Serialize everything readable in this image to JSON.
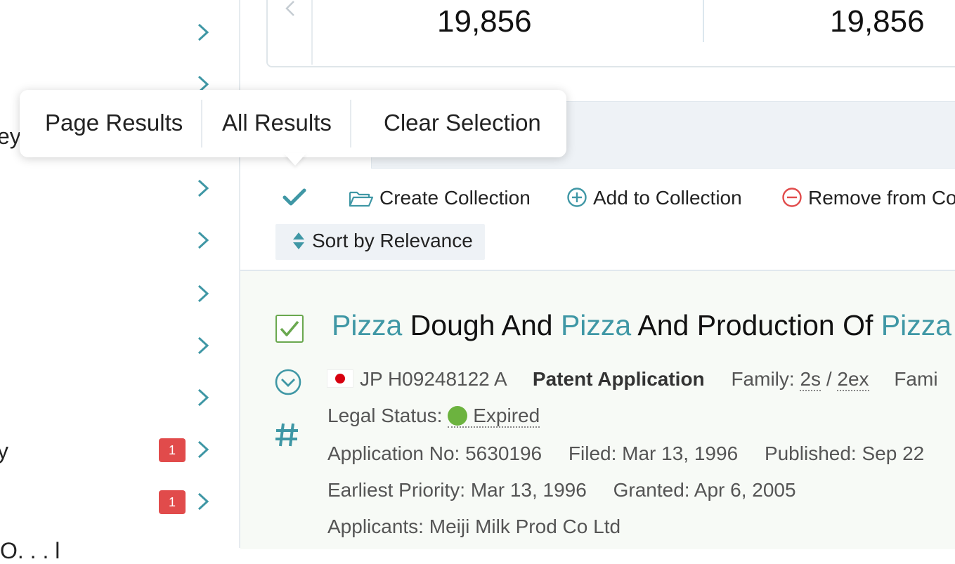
{
  "sidebar": {
    "rows": [
      {
        "label": "",
        "badge": ""
      },
      {
        "label": "",
        "badge": ""
      },
      {
        "label": "eys",
        "badge": ""
      },
      {
        "label": "",
        "badge": ""
      },
      {
        "label": "",
        "badge": ""
      },
      {
        "label": "",
        "badge": ""
      },
      {
        "label": "",
        "badge": ""
      },
      {
        "label": "",
        "badge": ""
      },
      {
        "label": "y",
        "badge": "1"
      },
      {
        "label": "",
        "badge": "1"
      }
    ],
    "bottom_text": "O. . . l"
  },
  "stats": {
    "value_1": "19,856",
    "value_2": "19,856"
  },
  "selection_popover": {
    "page_results": "Page Results",
    "all_results": "All Results",
    "clear_selection": "Clear Selection"
  },
  "toolbar": {
    "create_collection": "Create Collection",
    "add_to_collection": "Add to Collection",
    "remove_from_collection": "Remove from Co",
    "sort_label": "Sort by Relevance"
  },
  "result": {
    "title_parts": [
      {
        "text": "Pizza",
        "highlight": true
      },
      {
        "text": " Dough And ",
        "highlight": false
      },
      {
        "text": "Pizza",
        "highlight": true
      },
      {
        "text": " And Production Of ",
        "highlight": false
      },
      {
        "text": "Pizza",
        "highlight": true
      }
    ],
    "publication_number": "JP H09248122 A",
    "doc_type": "Patent Application",
    "family_label": "Family:",
    "family_simple": "2s",
    "family_sep": "/",
    "family_extended": "2ex",
    "family_more": "Fami",
    "legal_status_label": "Legal Status:",
    "legal_status_value": "Expired",
    "application_no": "Application No: 5630196",
    "filed": "Filed: Mar 13, 1996",
    "published": "Published: Sep 22",
    "earliest_priority": "Earliest Priority: Mar 13, 1996",
    "granted": "Granted: Apr 6, 2005",
    "applicants": "Applicants: Meiji Milk Prod Co Ltd"
  },
  "colors": {
    "accent_teal": "#3f97a5",
    "badge_red": "#e14b4b",
    "status_green": "#6cb33f",
    "remove_red": "#e14b4b"
  }
}
